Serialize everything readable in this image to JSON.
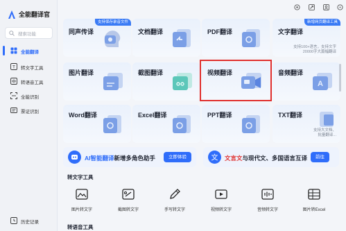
{
  "app": {
    "title": "全能翻译官"
  },
  "search": {
    "placeholder": "搜索功能"
  },
  "sidebar": {
    "items": [
      {
        "label": "全能翻译",
        "icon": "grid-icon",
        "active": true
      },
      {
        "label": "转文字工具",
        "icon": "text-convert-icon"
      },
      {
        "label": "转语音工具",
        "icon": "audio-icon"
      },
      {
        "label": "全能识别",
        "icon": "scan-icon"
      },
      {
        "label": "票证识别",
        "icon": "ticket-icon"
      }
    ],
    "history": {
      "label": "历史记录",
      "icon": "clock-icon"
    }
  },
  "cards": [
    {
      "title": "同声传译",
      "tag": "支持保存录音文件",
      "icon": "mic-head-icon"
    },
    {
      "title": "文档翻译",
      "icon": "document-icon"
    },
    {
      "title": "PDF翻译",
      "icon": "pdf-icon"
    },
    {
      "title": "文字翻译",
      "tag": "新增网页翻译工具",
      "desc": [
        "支持100+语言，支持文字",
        "20000字大篇幅翻译"
      ],
      "icon": "text-translate-icon"
    },
    {
      "title": "图片翻译",
      "icon": "image-icon"
    },
    {
      "title": "截图翻译",
      "icon": "screenshot-icon"
    },
    {
      "title": "视频翻译",
      "icon": "video-icon",
      "selected": true
    },
    {
      "title": "音频翻译",
      "icon": "audio-translate-icon"
    },
    {
      "title": "Word翻译",
      "icon": "word-icon"
    },
    {
      "title": "Excel翻译",
      "icon": "excel-icon"
    },
    {
      "title": "PPT翻译",
      "icon": "ppt-icon"
    },
    {
      "title": "TXT翻译",
      "desc": [
        "支持大文档、",
        "批量翻译..."
      ],
      "icon": "txt-icon"
    }
  ],
  "banners": [
    {
      "prefix": "AI智能翻译",
      "text": "新增多角色助手",
      "button": "立即体验"
    },
    {
      "prefix": "文言文",
      "text": "与现代文、多国语言互译",
      "button": "前往"
    }
  ],
  "sections": {
    "text_tools": {
      "title": "转文字工具",
      "tools": [
        {
          "label": "图片转文字",
          "icon": "image-to-text-icon"
        },
        {
          "label": "截图转文字",
          "icon": "screenshot-to-text-icon"
        },
        {
          "label": "手写转文字",
          "icon": "handwriting-icon"
        },
        {
          "label": "视频转文字",
          "icon": "video-to-text-icon"
        },
        {
          "label": "音频转文字",
          "icon": "audio-to-text-icon"
        },
        {
          "label": "图片转Excel",
          "icon": "image-to-excel-icon"
        }
      ]
    },
    "voice_tools": {
      "title": "转语音工具"
    }
  },
  "colors": {
    "accent": "#2f6dfa",
    "highlight": "#e0302e",
    "tag": "#3a7bf5"
  }
}
